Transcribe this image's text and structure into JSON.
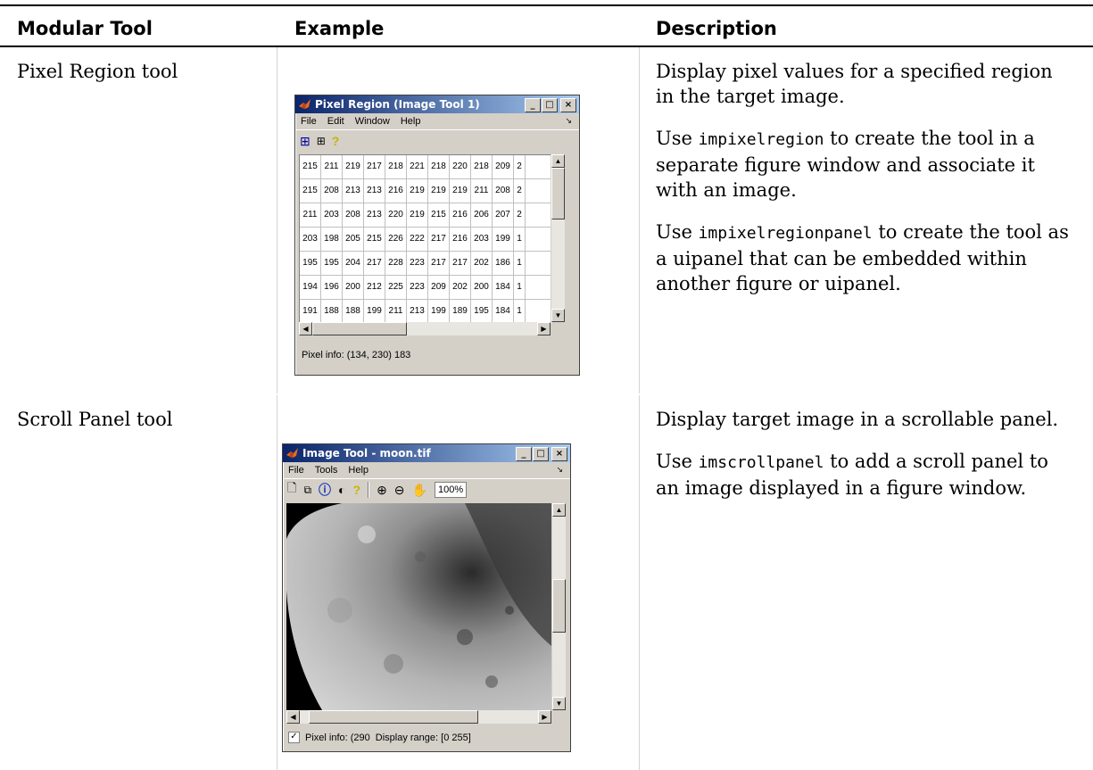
{
  "table": {
    "headers": [
      "Modular Tool",
      "Example",
      "Description"
    ],
    "rows": [
      {
        "tool": "Pixel Region tool",
        "description": [
          {
            "text": "Display pixel values for a specified region in the target image."
          },
          {
            "code": "impixelregion",
            "text": " to create the tool in a separate figure window and associate it with an image.",
            "prefix": "Use "
          },
          {
            "code": "impixelregionpanel",
            "text": " to create the tool as a uipanel that can be embedded within another figure or uipanel.",
            "prefix": "Use "
          }
        ]
      },
      {
        "tool": "Scroll Panel tool",
        "description": [
          {
            "text": "Display target image in a scrollable panel."
          },
          {
            "code": "imscrollpanel",
            "text": " to add a scroll panel to an image displayed in a figure window.",
            "prefix": "Use "
          }
        ]
      }
    ]
  },
  "pixel_region_window": {
    "title": "Pixel Region (Image Tool 1)",
    "menu": [
      "File",
      "Edit",
      "Window",
      "Help"
    ],
    "toolbar_icons": [
      "zoom-in-grid-icon",
      "zoom-out-grid-icon",
      "help-icon"
    ],
    "grid": [
      [
        "215",
        "211",
        "219",
        "217",
        "218",
        "221",
        "218",
        "220",
        "218",
        "209",
        "2"
      ],
      [
        "215",
        "208",
        "213",
        "213",
        "216",
        "219",
        "219",
        "219",
        "211",
        "208",
        "2"
      ],
      [
        "211",
        "203",
        "208",
        "213",
        "220",
        "219",
        "215",
        "216",
        "206",
        "207",
        "2"
      ],
      [
        "203",
        "198",
        "205",
        "215",
        "226",
        "222",
        "217",
        "216",
        "203",
        "199",
        "1"
      ],
      [
        "195",
        "195",
        "204",
        "217",
        "228",
        "223",
        "217",
        "217",
        "202",
        "186",
        "1"
      ],
      [
        "194",
        "196",
        "200",
        "212",
        "225",
        "223",
        "209",
        "202",
        "200",
        "184",
        "1"
      ],
      [
        "191",
        "188",
        "188",
        "199",
        "211",
        "213",
        "199",
        "189",
        "195",
        "184",
        "1"
      ]
    ],
    "status": "Pixel info: (134, 230)  183"
  },
  "image_tool_window": {
    "title": "Image Tool - moon.tif",
    "menu": [
      "File",
      "Tools",
      "Help"
    ],
    "zoom": "100%",
    "status_left": "Pixel info: (290",
    "status_right": "Display range: [0  255]"
  },
  "colors": {
    "title_start": "#0a246a",
    "title_end": "#a6caf0",
    "window_face": "#d4d0c8"
  }
}
